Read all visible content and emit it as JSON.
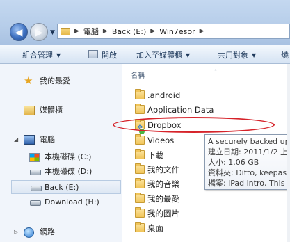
{
  "address": {
    "breadcrumbs": [
      "電腦",
      "Back (E:)",
      "Win7esor"
    ]
  },
  "toolbar": {
    "organize": "組合管理",
    "open": "開啟",
    "add_to_library": "加入至媒體櫃",
    "share_with": "共用對象",
    "overflow": "燒"
  },
  "nav": {
    "favorites": "我的最愛",
    "libraries": "媒體櫃",
    "computer": "電腦",
    "drives": [
      "本機磁碟 (C:)",
      "本機磁碟 (D:)",
      "Back (E:)",
      "Download (H:)"
    ],
    "network": "網路"
  },
  "content": {
    "column_name": "名稱",
    "items": [
      ".android",
      "Application Data",
      "Dropbox",
      "Videos",
      "下載",
      "我的文件",
      "我的音樂",
      "我的最愛",
      "我的圖片",
      "桌面"
    ],
    "hovered_item": "Dropbox"
  },
  "tooltip": {
    "lines": [
      "A securely backed up",
      "建立日期: 2011/1/2 上",
      "大小: 1.06 GB",
      "資料夾: Ditto, keepass",
      "檔案: iPad intro, This is"
    ]
  },
  "colors": {
    "annotation_ellipse": "#d6232a",
    "dropbox_blue": "#2a7bd8"
  }
}
